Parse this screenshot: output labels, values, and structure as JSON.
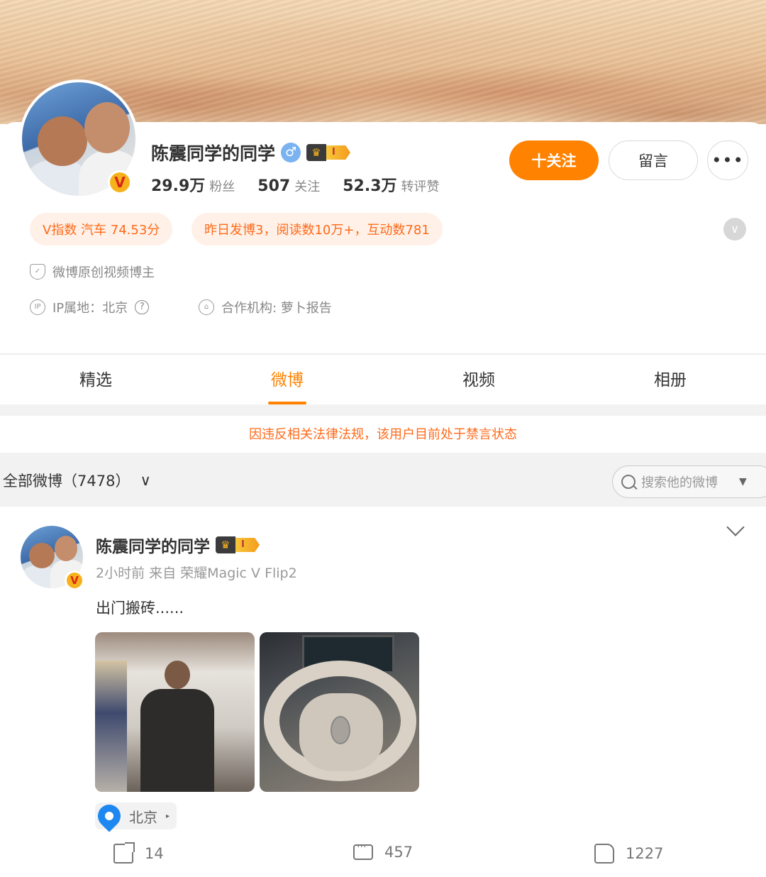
{
  "profile": {
    "name": "陈震同学的同学",
    "gender_icon": "♂",
    "crown_icon": "♛",
    "level_badge": "I",
    "verified_badge": "V",
    "stats": [
      {
        "num": "29.9万",
        "label": "粉丝"
      },
      {
        "num": "507",
        "label": "关注"
      },
      {
        "num": "52.3万",
        "label": "转评赞"
      }
    ],
    "buttons": {
      "follow": "十关注",
      "message": "留言",
      "more": "•••"
    },
    "tags": {
      "vindex": "V指数 汽车 74.53分",
      "activity": "昨日发博3，阅读数10万+，互动数781"
    },
    "verify_text": "微博原创视频博主",
    "ip_text": "IP属地：北京",
    "ip_help": "?",
    "org_text": "合作机构:  萝卜报告",
    "accent": "#ff8200"
  },
  "tabs": [
    "精选",
    "微博",
    "视频",
    "相册"
  ],
  "active_tab": "微博",
  "notice": "因违反相关法律法规，该用户目前处于禁言状态",
  "filter": {
    "all_posts": "全部微博（7478）",
    "search_placeholder": "搜索他的微博",
    "caret": "▼",
    "chevron": "∨"
  },
  "post": {
    "author": "陈震同学的同学",
    "meta": "2小时前  来自 荣耀Magic V Flip2",
    "text": "出门搬砖......",
    "location": "北京",
    "location_caret": "▸",
    "reposts": "14",
    "comments": "457",
    "likes": "1227"
  }
}
